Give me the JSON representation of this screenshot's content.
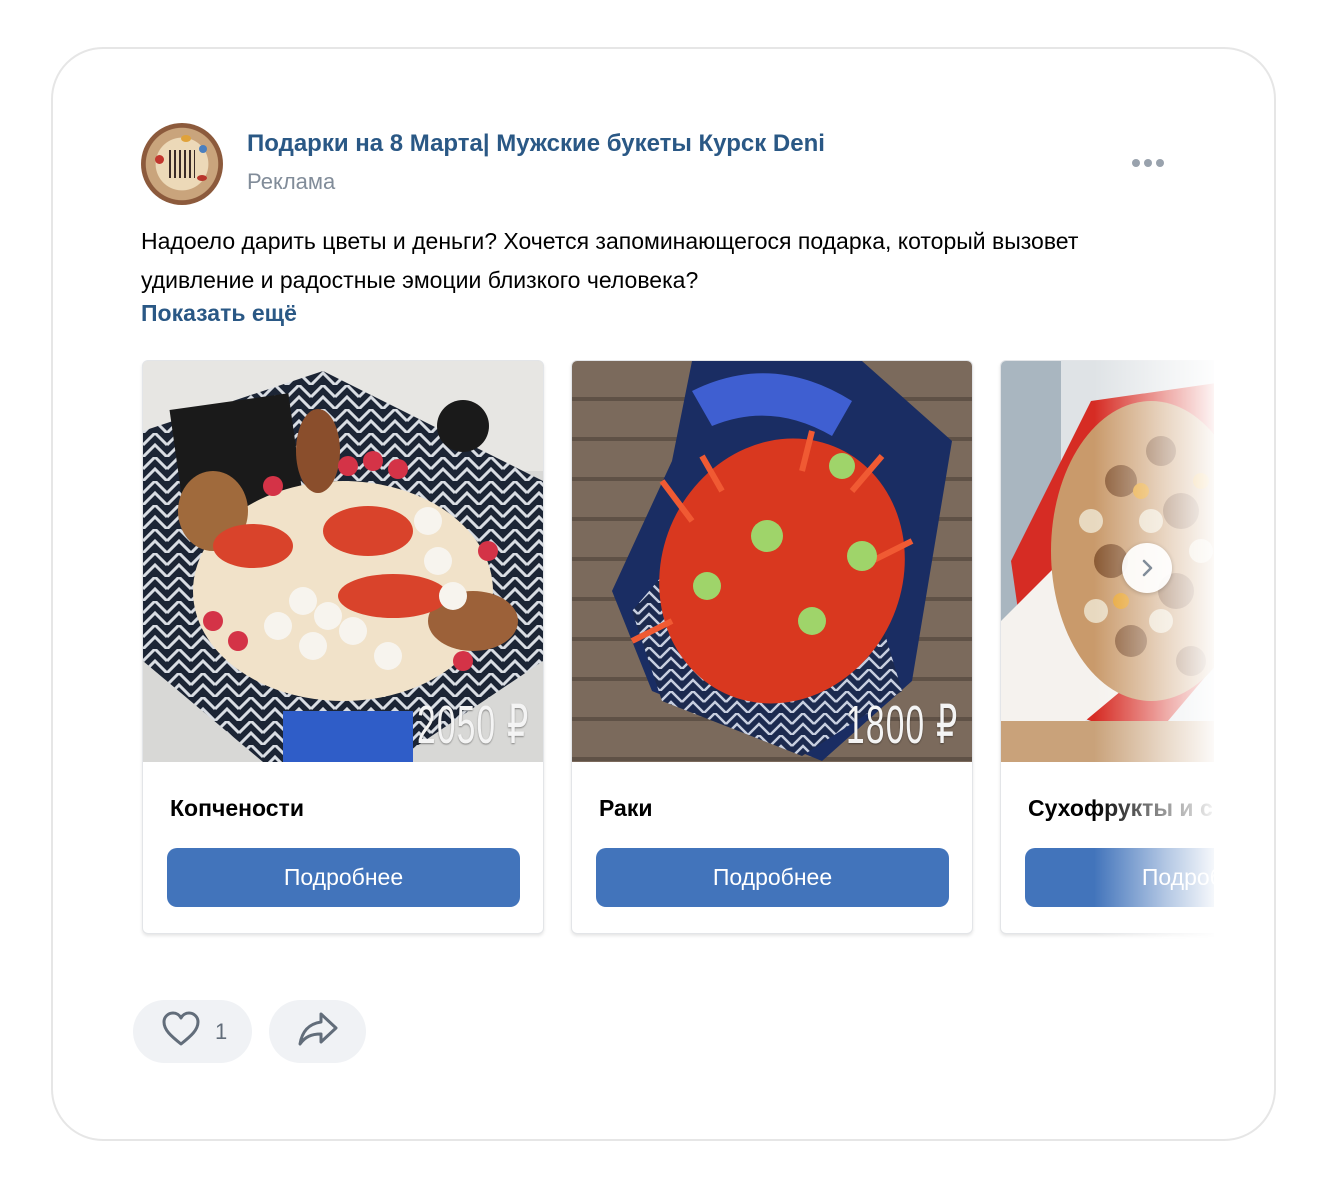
{
  "post": {
    "group_name": "Подарки на 8 Марта| Мужские букеты Курск Deni",
    "ad_label": "Реклама",
    "text": "Надоело дарить цветы и деньги? Хочется запоминающегося подарка, который вызовет удивление и радостные эмоции близкого человека?",
    "show_more": "Показать ещё"
  },
  "cards": [
    {
      "title": "Копчености",
      "price": "2050 ₽",
      "button": "Подробнее"
    },
    {
      "title": "Раки",
      "price": "1800 ₽",
      "button": "Подробнее"
    },
    {
      "title": "Сухофрукты и с",
      "price": "",
      "button": "Подробнее"
    }
  ],
  "actions": {
    "like_count": "1"
  },
  "icons": {
    "more": "more-horizontal-icon",
    "like": "heart-icon",
    "share": "share-icon",
    "next": "chevron-right-icon"
  },
  "colors": {
    "link": "#2a5885",
    "button": "#4274bb",
    "muted": "#818c99"
  }
}
